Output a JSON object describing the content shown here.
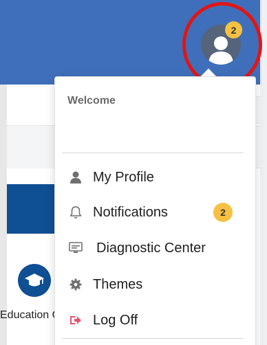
{
  "header": {
    "avatar_badge": "2"
  },
  "dropdown": {
    "welcome": "Welcome",
    "items": [
      {
        "label": "My Profile",
        "icon": "user-icon"
      },
      {
        "label": "Notifications",
        "icon": "bell-icon",
        "badge": "2"
      },
      {
        "label": "Diagnostic Center",
        "icon": "monitor-icon"
      },
      {
        "label": "Themes",
        "icon": "gear-icon"
      },
      {
        "label": "Log Off",
        "icon": "logout-icon"
      }
    ]
  },
  "tiles": [
    {
      "label": "Education Course"
    }
  ],
  "colors": {
    "header": "#3f6fba",
    "badge": "#f6c143",
    "highlight_ring": "#e01616",
    "tile": "#0f4f93",
    "logout_icon": "#e8506a"
  }
}
